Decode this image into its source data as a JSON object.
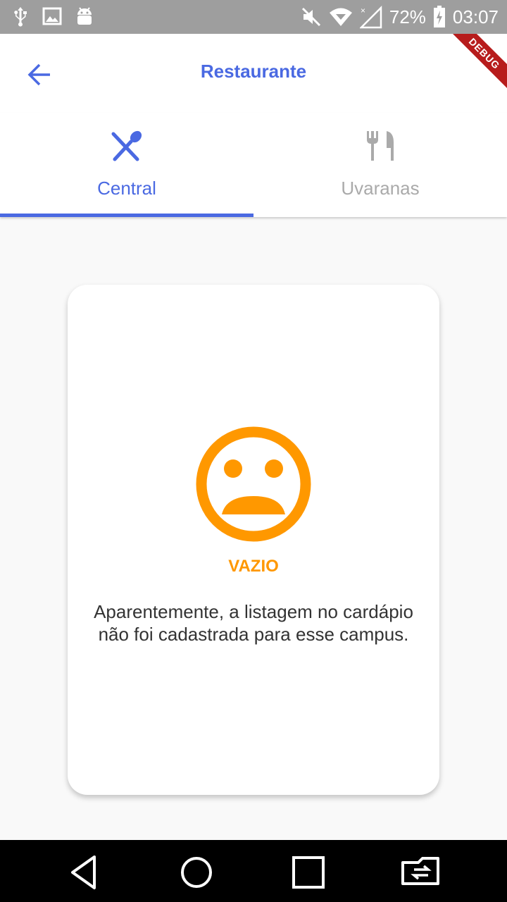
{
  "status_bar": {
    "battery_percent": "72%",
    "time": "03:07",
    "icons": [
      "usb-icon",
      "image-icon",
      "android-icon",
      "mute-icon",
      "wifi-icon",
      "signal-icon",
      "battery-charging-icon"
    ]
  },
  "app_bar": {
    "title": "Restaurante",
    "debug_banner": "DEBUG"
  },
  "tabs": [
    {
      "label": "Central",
      "icon": "spoon-knife-icon",
      "selected": true
    },
    {
      "label": "Uvaranas",
      "icon": "fork-knife-icon",
      "selected": false
    }
  ],
  "empty_state": {
    "icon": "sad-face-icon",
    "title": "VAZIO",
    "message": "Aparentemente, a listagem no cardápio não foi cadastrada para esse campus."
  },
  "nav_bar": {
    "buttons": [
      "back-icon",
      "home-icon",
      "recents-icon",
      "rotate-icon"
    ]
  },
  "colors": {
    "accent": "#4a69e2",
    "empty_state": "#ff9800",
    "inactive_tab": "#aaaaaa",
    "status_bar": "#9e9e9e"
  }
}
